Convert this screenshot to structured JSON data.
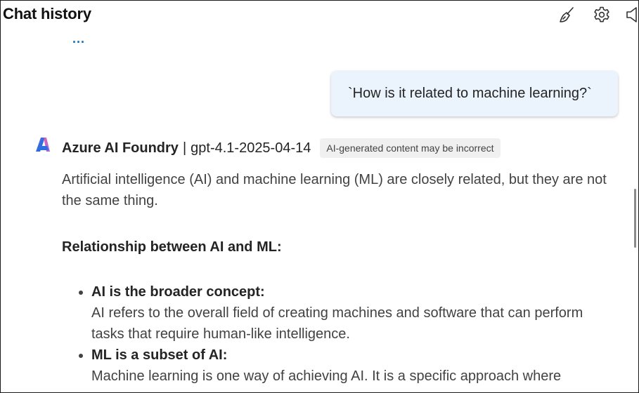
{
  "header": {
    "title": "Chat history"
  },
  "icons": {
    "clear": "broom-icon",
    "settings": "gear-icon",
    "speaker": "speaker-icon"
  },
  "loading": {
    "ellipsis": "..."
  },
  "user_message": {
    "text": "`How is it related to machine learning?`"
  },
  "assistant": {
    "name": "Azure AI Foundry",
    "separator": "|",
    "model": "gpt-4.1-2025-04-14",
    "disclaimer": "AI-generated content may be incorrect",
    "intro": "Artificial intelligence (AI) and machine learning (ML) are closely related, but they are not the same thing.",
    "section_heading": "Relationship between AI and ML:",
    "items": [
      {
        "title": "AI is the broader concept:",
        "text": "AI refers to the overall field of creating machines and software that can perform tasks that require human-like intelligence."
      },
      {
        "title": "ML is a subset of AI:",
        "text": "Machine learning is one way of achieving AI. It is a specific approach where"
      }
    ]
  },
  "colors": {
    "user_bubble": "#ebf3fc",
    "accent": "#0f6cbd",
    "text_primary": "#242424",
    "text_secondary": "#424242",
    "badge_bg": "#f0f0f0"
  }
}
